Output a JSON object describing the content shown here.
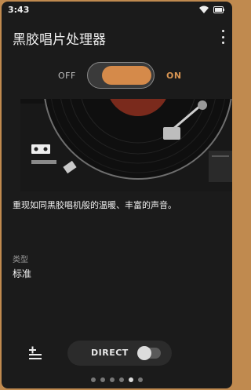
{
  "status_bar": {
    "time": "3:43"
  },
  "appbar": {
    "title": "黑胶唱片处理器"
  },
  "power_toggle": {
    "off_label": "OFF",
    "on_label": "ON",
    "state": "on"
  },
  "main": {
    "caption": "重现如同黑胶唱机般的温暖、丰富的声音。",
    "type_label": "类型",
    "type_value": "标准"
  },
  "bottom_bar": {
    "direct_label": "DIRECT",
    "direct_on": false
  },
  "pager": {
    "count": 6,
    "active_index": 4
  },
  "colors": {
    "accent": "#d58a4a",
    "frame": "#c08a4f",
    "background": "#1b1b1b"
  },
  "icons": {
    "more": "more-vert-icon",
    "add_list": "playlist-add-icon",
    "wifi": "wifi-icon",
    "battery": "battery-icon"
  }
}
